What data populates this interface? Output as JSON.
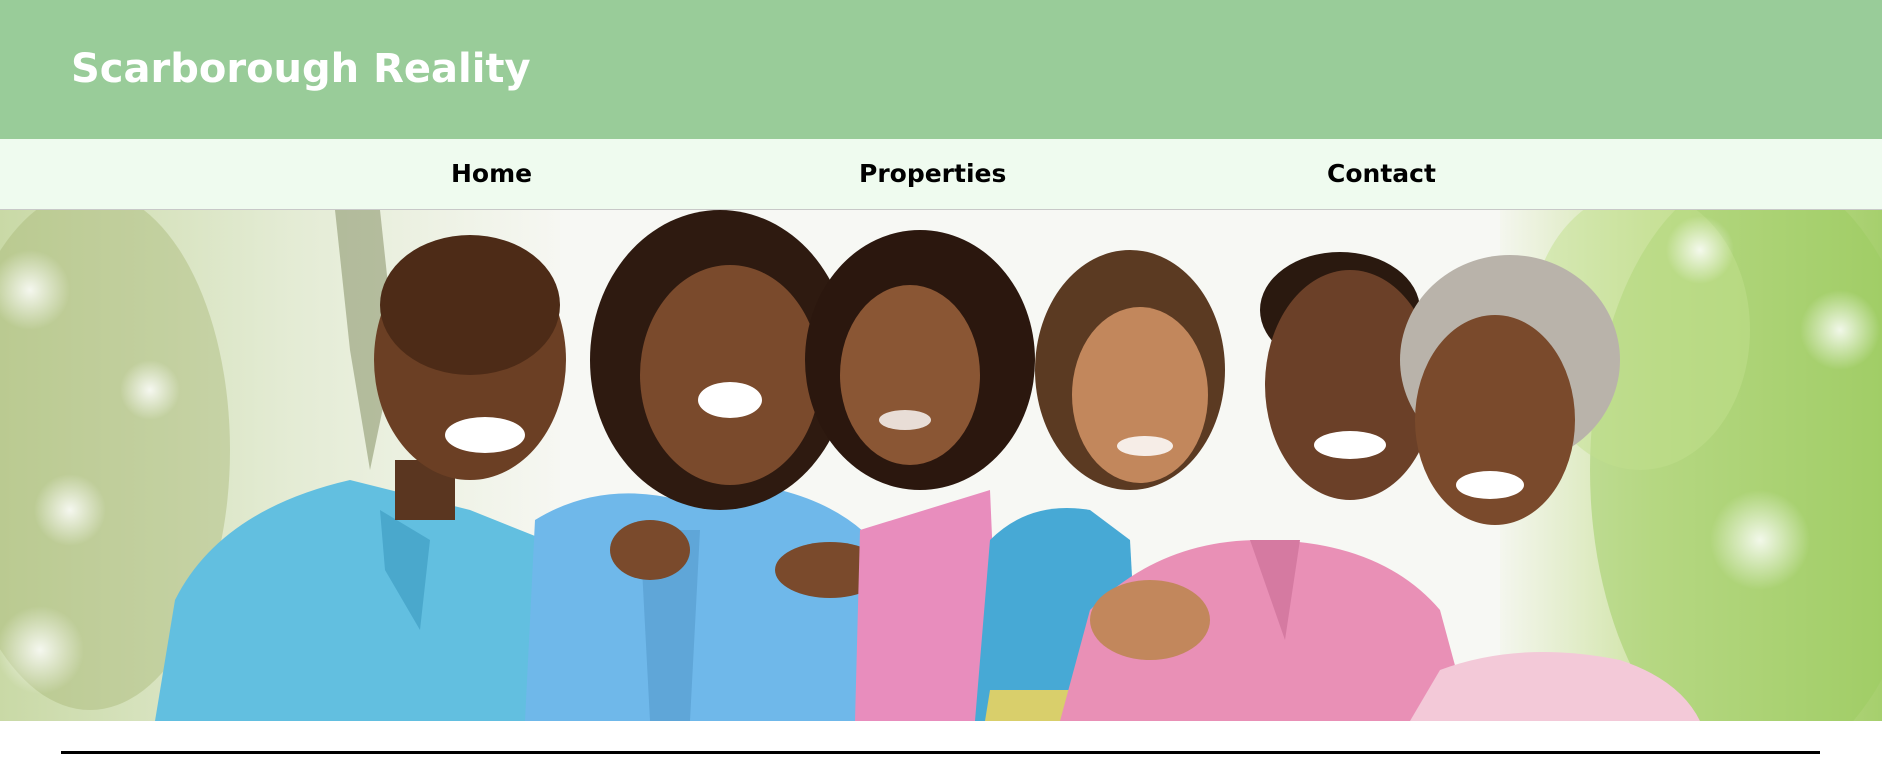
{
  "header": {
    "site_title": "Scarborough Reality",
    "background_color": "#99cc99"
  },
  "nav": {
    "background_color": "#effbef",
    "items": [
      {
        "label": "Home"
      },
      {
        "label": "Properties"
      },
      {
        "label": "Contact"
      }
    ]
  },
  "hero": {
    "image_subject": "smiling-family-photo"
  }
}
